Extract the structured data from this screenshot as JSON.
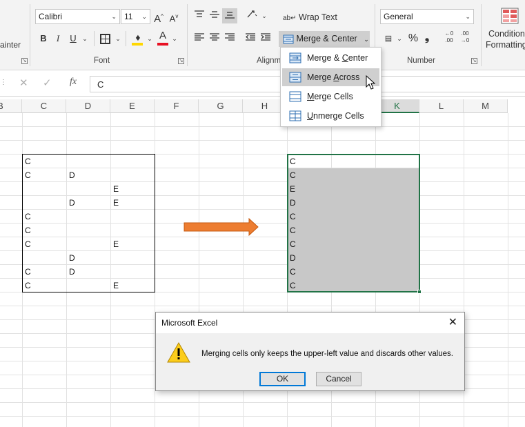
{
  "ribbon": {
    "clipboard": {
      "format_painter_label": "ainter"
    },
    "font": {
      "font_name": "Calibri",
      "font_size": "11",
      "grow_label": "A",
      "shrink_label": "A",
      "bold_label": "B",
      "italic_label": "I",
      "underline_label": "U",
      "group_label": "Font"
    },
    "alignment": {
      "wrap_text_label": "Wrap Text",
      "merge_center_label": "Merge & Center",
      "group_label": "Alignm"
    },
    "number": {
      "format_value": "General",
      "group_label": "Number"
    },
    "styles": {
      "conditional_label_1": "Condition",
      "conditional_label_2": "Formatting"
    }
  },
  "formula_bar": {
    "fx_label": "fx",
    "value": "C"
  },
  "columns": [
    "B",
    "C",
    "D",
    "E",
    "F",
    "G",
    "H",
    "I",
    "J",
    "K",
    "L",
    "M"
  ],
  "active_column": "K",
  "source_table": {
    "rows": [
      [
        "C",
        "",
        ""
      ],
      [
        "C",
        "D",
        ""
      ],
      [
        "",
        "",
        "E"
      ],
      [
        "",
        "D",
        "E"
      ],
      [
        "C",
        "",
        ""
      ],
      [
        "C",
        "",
        ""
      ],
      [
        "C",
        "",
        "E"
      ],
      [
        "",
        "D",
        ""
      ],
      [
        "C",
        "D",
        ""
      ],
      [
        "C",
        "",
        "E"
      ]
    ]
  },
  "result_column": {
    "values": [
      "C",
      "C",
      "E",
      "D",
      "C",
      "C",
      "C",
      "D",
      "C",
      "C"
    ]
  },
  "merge_menu": {
    "items": [
      {
        "label": "Merge & Center",
        "accel": "C"
      },
      {
        "label": "Merge Across",
        "accel": "A"
      },
      {
        "label": "Merge Cells",
        "accel": "M"
      },
      {
        "label": "Unmerge Cells",
        "accel": "U"
      }
    ],
    "hovered_index": 1
  },
  "dialog": {
    "title": "Microsoft Excel",
    "message": "Merging cells only keeps the upper-left value and discards other values.",
    "ok_label": "OK",
    "cancel_label": "Cancel"
  },
  "colors": {
    "excel_green": "#217346",
    "arrow_orange": "#ed7d31",
    "selection_gray": "#c8c8c8",
    "highlight_yellow": "#ffd700",
    "font_red": "#e81123",
    "dialog_blue": "#0078d7"
  }
}
